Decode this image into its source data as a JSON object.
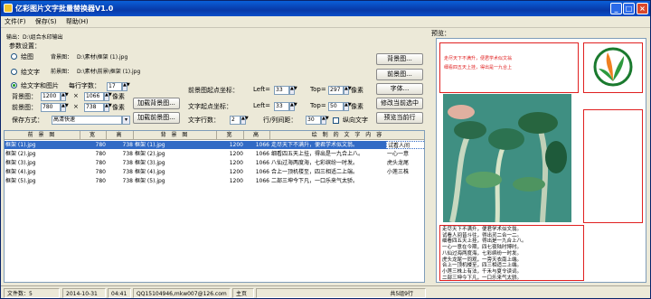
{
  "window": {
    "title": "亿彩图片文字批量替换器V1.0"
  },
  "menu": [
    "文件(F)",
    "保存(S)",
    "帮助(H)"
  ],
  "output": {
    "label": "输出：D:\\组合水印输出"
  },
  "params": {
    "group_label": "参数设置：",
    "mode_image": "绘图",
    "mode_text": "绘文字",
    "mode_both": "绘文字和图片",
    "bg_image_label": "背景图：",
    "bg_image_path": "D:\\素材\\框架 (1).jpg",
    "fg_image_label": "前景图：",
    "fg_image_path": "D:\\素材\\前景\\框架 (1).jpg",
    "chars_per_line_label": "每行字数：",
    "chars_per_line": "17",
    "bg_label": "背景图：",
    "bg_w": "1200",
    "bg_h": "1066",
    "fg_label": "前景图：",
    "fg_w": "780",
    "fg_h": "738",
    "times": "×",
    "px": "像素",
    "save_mode_label": "保存方式：",
    "save_mode": "高清快速",
    "load_bg_button": "加载背景图...",
    "load_fg_button": "加载前景图...",
    "fg_origin_label": "前景图起点坐标：",
    "left_label": "Left=",
    "top_label": "Top=",
    "fg_left": "33",
    "fg_top": "297",
    "text_origin_label": "文字起点坐标：",
    "text_left": "33",
    "text_top": "50",
    "text_lines_label": "文字行数：",
    "text_lines": "2",
    "line_spacing_label": "行/列间距：",
    "line_spacing": "30",
    "vertical_label": "纵向文字"
  },
  "right_buttons": [
    "背景图...",
    "前景图...",
    "字体...",
    "修改当前选中",
    "预览当前行"
  ],
  "table": {
    "headers": [
      "前 景 图",
      "宽",
      "高",
      "背 景 图",
      "宽",
      "高",
      "绘 制 的 文 字 内 容"
    ],
    "rows": [
      [
        "框架 (1).jpg",
        "780",
        "738",
        "框架 (1).jpg",
        "1200",
        "1066",
        "走尽天下不满升，便君学术似文翁。",
        "试看人间"
      ],
      [
        "框架 (2).jpg",
        "780",
        "738",
        "框架 (2).jpg",
        "1200",
        "1066",
        "细看四五天上挂，得出是一九合上八。",
        "一心一意"
      ],
      [
        "框架 (3).jpg",
        "780",
        "738",
        "框架 (3).jpg",
        "1200",
        "1066",
        "八仙过海两度海，七彩缤纷一时发。",
        "虎头龙尾"
      ],
      [
        "框架 (4).jpg",
        "780",
        "738",
        "框架 (4).jpg",
        "1200",
        "1066",
        "合上一顶机楼至，四三相适二上端。",
        "小莲三株"
      ],
      [
        "框架 (5).jpg",
        "780",
        "738",
        "框架 (5).jpg",
        "1200",
        "1066",
        "二部三坤今下凡，一口乐来气太骄。",
        ""
      ]
    ]
  },
  "status": {
    "count": "文件数：5",
    "date": "2014-10-31",
    "time": "04:41",
    "contact": "QQ15104946,mkw007@126.com",
    "home": "主页",
    "summary": "共5组9行"
  },
  "preview": {
    "label": "预览：",
    "header_line1": "走尽天下不满升，便君学术似文翁",
    "header_line2": "细看四五天上挂，得出是一九合上",
    "text_lines": [
      "走尽天下不满升，便君学术似文翁。",
      "试看人间皆斗往，得出灵二合一二。",
      "细看四五天上挂，得出是一九合上八。",
      "一心一意在今期，四七夜陆时博时。",
      "八仙过海两度海，七彩缤纷一时发。",
      "虎头龙尾一同观，一旁天衣南上端。",
      "合上一顶机楼至，四三相适二上端。",
      "小莲三株上有法，千禾与夏令读词。",
      "二部三坤今下凡，一口乐来气太骄。"
    ]
  },
  "colors": {
    "title_bar": "#0a4fc8",
    "selected_row": "#316ac5",
    "preview_border": "#e02020"
  }
}
